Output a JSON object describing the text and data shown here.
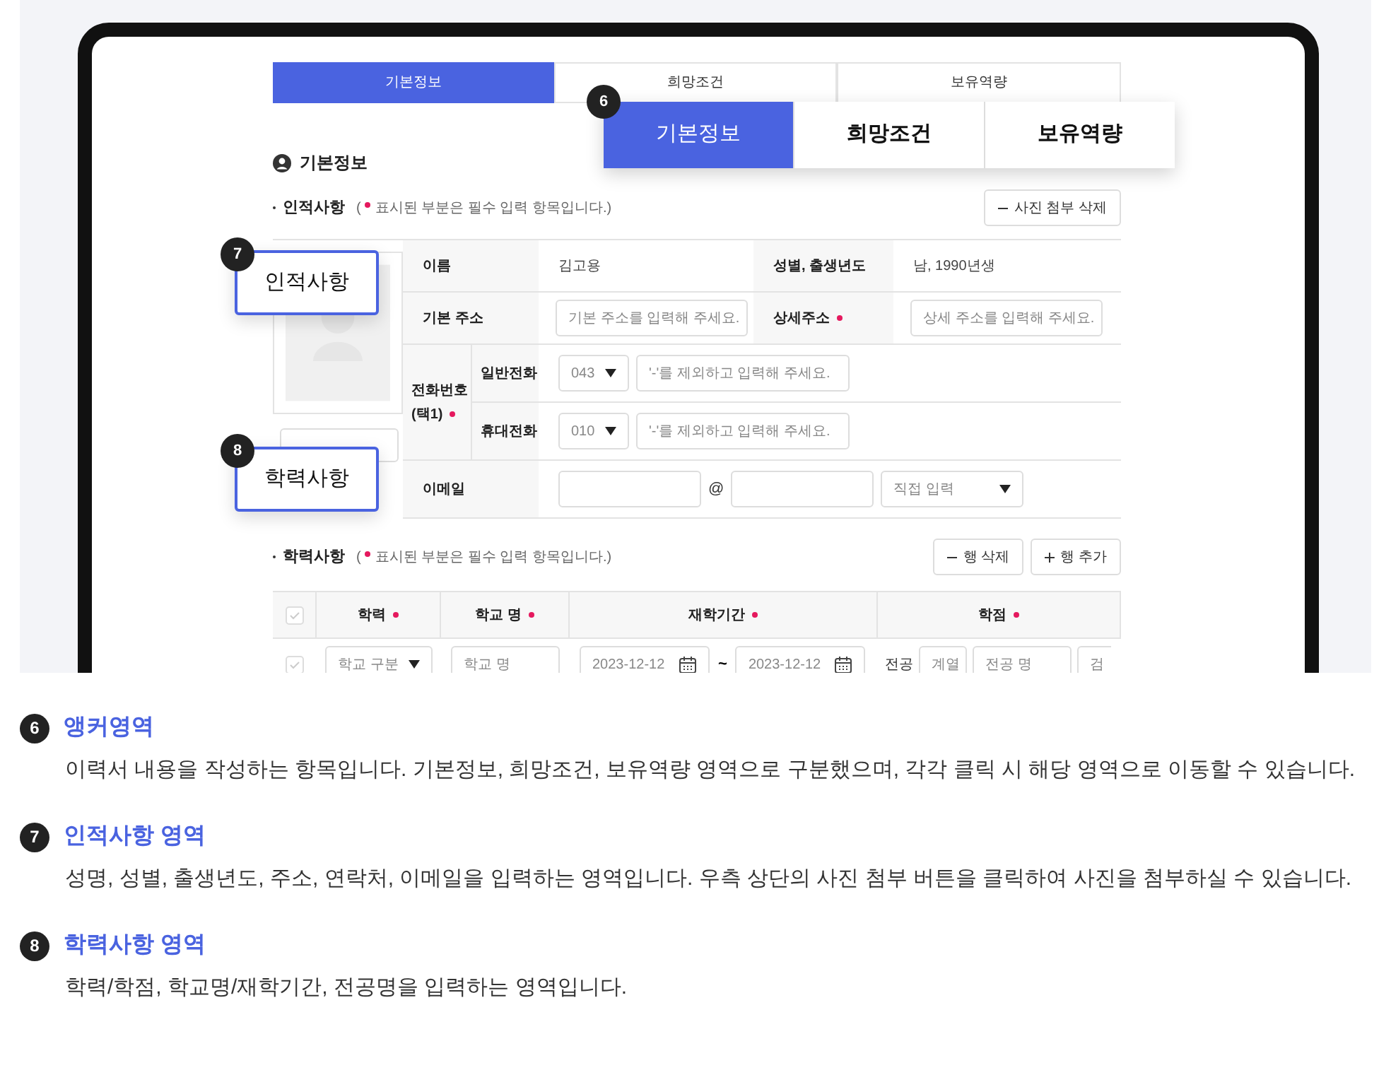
{
  "nav_tabs": [
    {
      "label": "기본정보",
      "selected": true
    },
    {
      "label": "희망조건",
      "selected": false
    },
    {
      "label": "보유역량",
      "selected": false
    }
  ],
  "section_title": "기본정보",
  "personal": {
    "title": "인적사항",
    "note_open": "(",
    "note": "표시된 부분은 필수 입력 항목입니다.)",
    "photo_delete_button": "사진 첨부 삭제",
    "name_label": "이름",
    "name_value": "김고용",
    "gender_label": "성별, 출생년도",
    "gender_value": "남, 1990년생",
    "address_label": "기본 주소",
    "address_placeholder": "기본 주소를 입력해 주세요.",
    "detail_label": "상세주소",
    "detail_required": true,
    "detail_placeholder": "상세 주소를 입력해 주세요.",
    "phone_label": "전화번호",
    "phone_label_2": "(택1)",
    "phone_required": true,
    "phones": [
      {
        "label": "일반전화",
        "code": "043",
        "placeholder": "'-'를 제외하고 입력해 주세요."
      },
      {
        "label": "휴대전화",
        "code": "010",
        "placeholder": "'-'를 제외하고 입력해 주세요."
      }
    ],
    "email_label": "이메일",
    "email_at": "@",
    "email_domain": "직접 입력"
  },
  "education": {
    "title": "학력사항",
    "note_open": "(",
    "note": "표시된 부분은 필수 입력 항목입니다.)",
    "delete_button": "행 삭제",
    "add_button": "행 추가",
    "header_checked": false,
    "row_checked": false,
    "columns": [
      {
        "label": "학력",
        "required": true
      },
      {
        "label": "학교 명",
        "required": true
      },
      {
        "label": "재학기간",
        "required": true
      },
      {
        "label": "학점",
        "required": true
      }
    ],
    "row": {
      "school_type": "학교 구분",
      "school_name": "학교 명",
      "start_date": "2023-12-12",
      "tilde": "~",
      "end_date": "2023-12-12",
      "major_label": "전공",
      "field": "계열",
      "major_name": "전공 명",
      "extra": "검"
    }
  },
  "callouts": {
    "tabs_number": "6",
    "tabs": [
      {
        "label": "기본정보",
        "selected": true
      },
      {
        "label": "희망조건",
        "selected": false
      },
      {
        "label": "보유역량",
        "selected": false
      }
    ],
    "personal_number": "7",
    "personal_label": "인적사항",
    "education_number": "8",
    "education_label": "학력사항"
  },
  "descriptions": [
    {
      "number": "6",
      "title": "앵커영역",
      "text": "이력서 내용을 작성하는 항목입니다. 기본정보, 희망조건, 보유역량 영역으로 구분했으며, 각각 클릭 시 해당 영역으로 이동할 수 있습니다."
    },
    {
      "number": "7",
      "title": "인적사항 영역",
      "text": "성명, 성별, 출생년도, 주소, 연락처, 이메일을 입력하는 영역입니다. 우측 상단의 사진 첨부 버튼을 클릭하여 사진을 첨부하실 수 있습니다."
    },
    {
      "number": "8",
      "title": "학력사항 영역",
      "text": "학력/학점, 학교명/재학기간, 전공명을 입력하는 영역입니다."
    }
  ]
}
